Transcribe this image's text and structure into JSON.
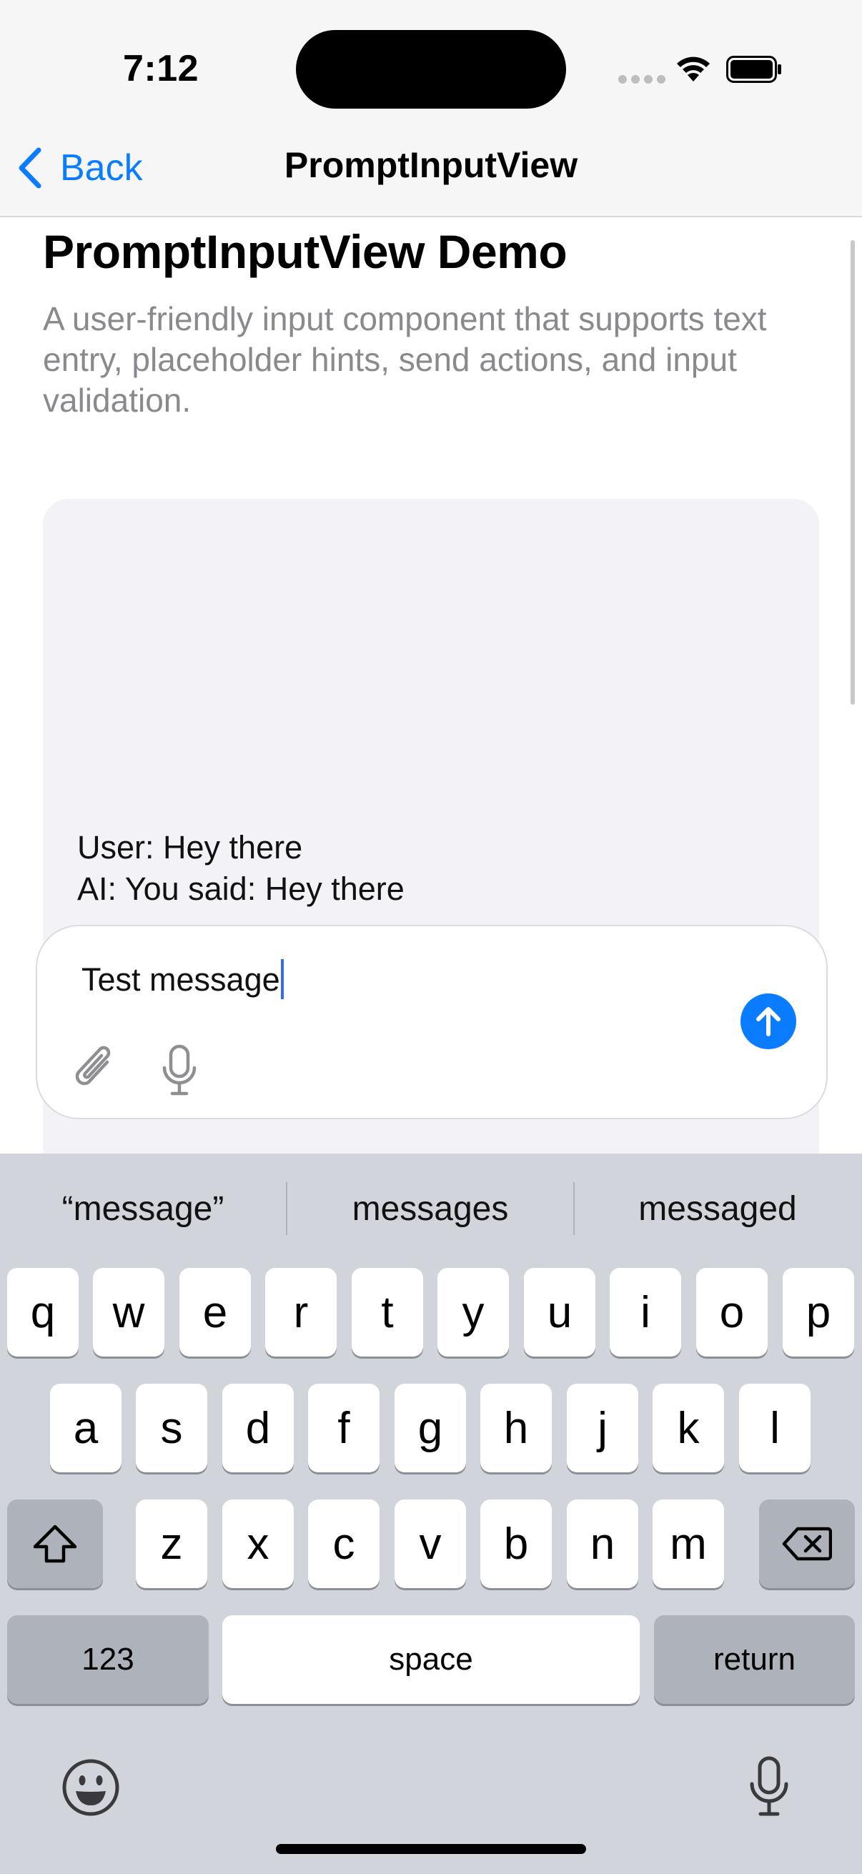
{
  "status_bar": {
    "time": "7:12",
    "icons": [
      "cellular-dots-icon",
      "wifi-icon",
      "battery-icon"
    ]
  },
  "nav": {
    "back_label": "Back",
    "title": "PromptInputView"
  },
  "page": {
    "title": "PromptInputView Demo",
    "description": "A user-friendly input component that supports text entry, placeholder hints, send actions, and input validation."
  },
  "chat": {
    "messages": [
      {
        "text": "User: Hey there"
      },
      {
        "text": "AI: You said: Hey there"
      }
    ]
  },
  "input": {
    "value": "Test message",
    "icons": [
      "paperclip-icon",
      "microphone-icon",
      "send-arrow-icon"
    ]
  },
  "keyboard": {
    "suggestions": [
      "“message”",
      "messages",
      "messaged"
    ],
    "row1": [
      "q",
      "w",
      "e",
      "r",
      "t",
      "y",
      "u",
      "i",
      "o",
      "p"
    ],
    "row2": [
      "a",
      "s",
      "d",
      "f",
      "g",
      "h",
      "j",
      "k",
      "l"
    ],
    "row3": [
      "z",
      "x",
      "c",
      "v",
      "b",
      "n",
      "m"
    ],
    "numbers_label": "123",
    "space_label": "space",
    "return_label": "return"
  },
  "colors": {
    "accent": "#0a7cff",
    "caret": "#2f6df6",
    "secondary_text": "#8a8a8e",
    "keyboard_bg": "#d1d4da"
  }
}
